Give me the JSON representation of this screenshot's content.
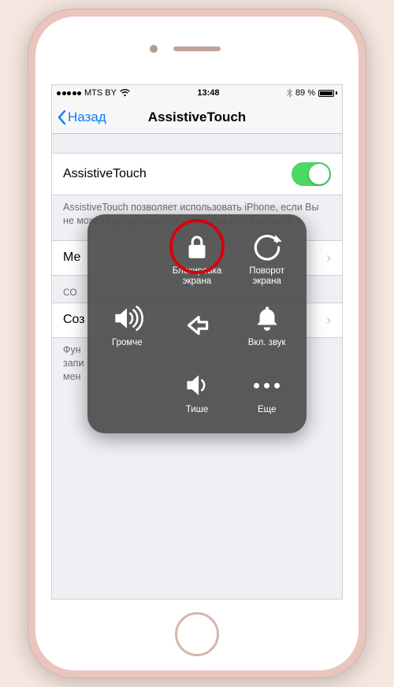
{
  "status": {
    "carrier": "MTS BY",
    "time": "13:48",
    "battery": "89 %"
  },
  "nav": {
    "back": "Назад",
    "title": "AssistiveTouch"
  },
  "main": {
    "toggle_label": "AssistiveTouch",
    "description": "AssistiveTouch позволяет использовать iPhone, если Вы не можете дотрагиваться до экрана или Вам необ",
    "menu_row": "Ме",
    "section_header": "СО",
    "create_row": "Соз",
    "footer": "Фун\nзапи\nмен"
  },
  "overlay": {
    "lock": "Блокировка\nэкрана",
    "rotate": "Поворот\nэкрана",
    "louder": "Громче",
    "sound_on": "Вкл. звук",
    "quieter": "Тише",
    "more": "Еще"
  },
  "colors": {
    "accent": "#0a7aff",
    "toggle_on": "#4cd964",
    "highlight": "#d8000c",
    "bg": "#efeff4"
  }
}
